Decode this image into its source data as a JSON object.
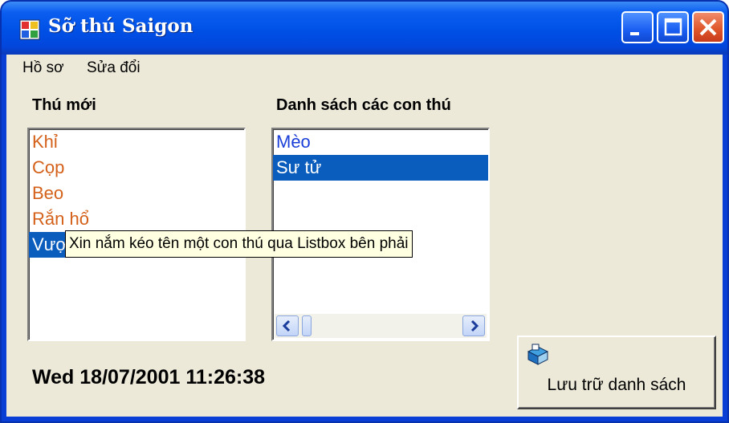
{
  "window": {
    "title": "Sỡ thú Saigon",
    "icon": "app-window-icon",
    "controls": [
      "minimize-icon",
      "maximize-icon",
      "close-icon"
    ]
  },
  "menu": {
    "items": [
      {
        "label": "Hồ sơ"
      },
      {
        "label": "Sửa đổi"
      }
    ]
  },
  "left_panel": {
    "label": "Thú mới",
    "items": [
      "Khỉ",
      "Cọp",
      "Beo",
      "Rắn hổ",
      "Vượn"
    ],
    "selected_index": 4
  },
  "right_panel": {
    "label": "Danh sách các con thú",
    "items": [
      "Mèo",
      "Sư tử"
    ],
    "selected_index": 1
  },
  "tooltip": "Xin nắm kéo tên một con thú qua Listbox bên phải",
  "datetime": "Wed 18/07/2001 11:26:38",
  "save_button": {
    "label": "Lưu trữ danh sách",
    "icon": "save-disk-icon"
  },
  "colors": {
    "title_bar": "#0050e6",
    "selection": "#0a5cbd",
    "new_item_text": "#d4601a",
    "list_item_text": "#1a3fd9",
    "close_button": "#e0582c",
    "window_bg": "#ece9d8",
    "tooltip_bg": "#ffffe1"
  }
}
